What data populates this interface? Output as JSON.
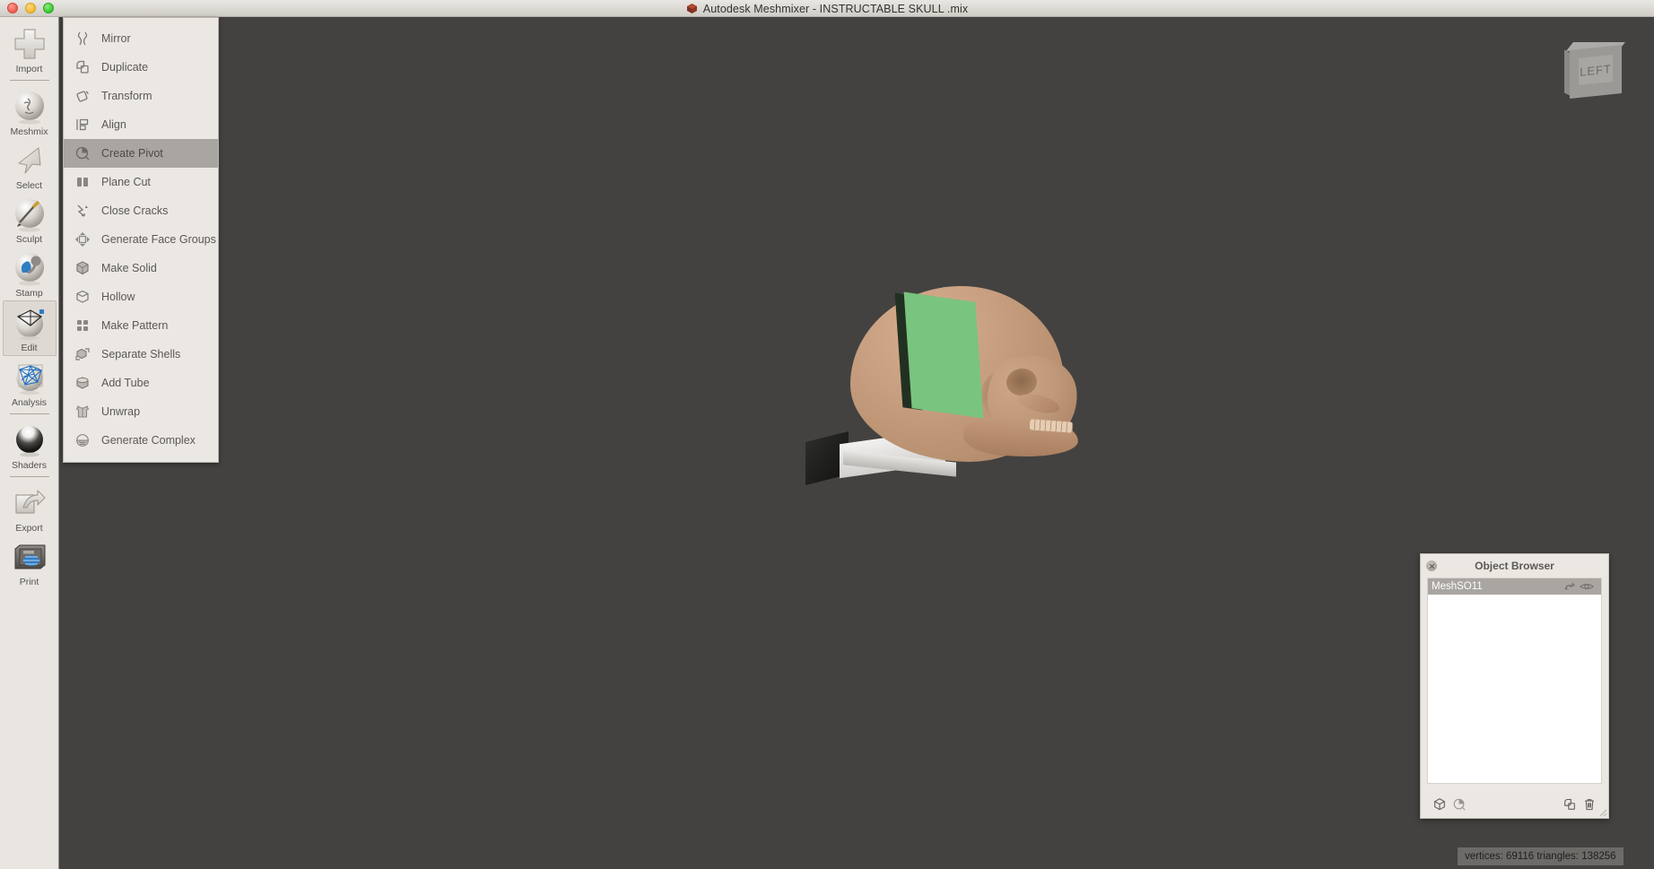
{
  "window": {
    "title": "Autodesk Meshmixer - INSTRUCTABLE SKULL .mix",
    "app_logo": "meshmixer-logo-icon",
    "traffic_lights": [
      "close-button",
      "minimize-button",
      "zoom-button"
    ]
  },
  "rail": {
    "items": [
      {
        "label": "Import",
        "icon": "plus-icon",
        "active": false,
        "separator_after": true
      },
      {
        "label": "Meshmix",
        "icon": "face-sphere-icon",
        "active": false,
        "separator_after": false
      },
      {
        "label": "Select",
        "icon": "cursor-arrow-icon",
        "active": false,
        "separator_after": false
      },
      {
        "label": "Sculpt",
        "icon": "brush-sphere-icon",
        "active": false,
        "separator_after": false
      },
      {
        "label": "Stamp",
        "icon": "stamp-sphere-icon",
        "active": false,
        "separator_after": false
      },
      {
        "label": "Edit",
        "icon": "mesh-sphere-icon",
        "active": true,
        "separator_after": false
      },
      {
        "label": "Analysis",
        "icon": "wireframe-sphere-icon",
        "active": false,
        "separator_after": true
      },
      {
        "label": "Shaders",
        "icon": "shaded-sphere-icon",
        "active": false,
        "separator_after": true
      },
      {
        "label": "Export",
        "icon": "export-arrow-icon",
        "active": false,
        "separator_after": false
      },
      {
        "label": "Print",
        "icon": "printer-icon",
        "active": false,
        "separator_after": false
      }
    ]
  },
  "edit_menu": {
    "items": [
      {
        "label": "Mirror",
        "icon": "mirror-icon",
        "selected": false
      },
      {
        "label": "Duplicate",
        "icon": "duplicate-icon",
        "selected": false
      },
      {
        "label": "Transform",
        "icon": "transform-icon",
        "selected": false
      },
      {
        "label": "Align",
        "icon": "align-icon",
        "selected": false
      },
      {
        "label": "Create Pivot",
        "icon": "pivot-icon",
        "selected": true
      },
      {
        "label": "Plane Cut",
        "icon": "plane-cut-icon",
        "selected": false
      },
      {
        "label": "Close Cracks",
        "icon": "close-cracks-icon",
        "selected": false
      },
      {
        "label": "Generate Face Groups",
        "icon": "face-groups-icon",
        "selected": false
      },
      {
        "label": "Make Solid",
        "icon": "make-solid-icon",
        "selected": false
      },
      {
        "label": "Hollow",
        "icon": "hollow-icon",
        "selected": false
      },
      {
        "label": "Make Pattern",
        "icon": "make-pattern-icon",
        "selected": false
      },
      {
        "label": "Separate Shells",
        "icon": "separate-shells-icon",
        "selected": false
      },
      {
        "label": "Add Tube",
        "icon": "add-tube-icon",
        "selected": false
      },
      {
        "label": "Unwrap",
        "icon": "unwrap-icon",
        "selected": false
      },
      {
        "label": "Generate Complex",
        "icon": "generate-complex-icon",
        "selected": false
      }
    ]
  },
  "viewport": {
    "viewcube_label": "LEFT",
    "background_color": "#434240",
    "model": {
      "name": "skull-mesh",
      "surface_color": "#c79f80",
      "pivot_plane_color": "#79c47e",
      "base_block_color": "#1a1a19",
      "base_slab_color": "#eeedea"
    }
  },
  "object_browser": {
    "title": "Object Browser",
    "close_icon": "close-icon",
    "rows": [
      {
        "name": "MeshSO11",
        "selected": true,
        "icons": [
          "magnet-icon",
          "eye-visible-icon"
        ]
      }
    ],
    "footer_icons_left": [
      "cube-icon",
      "pivot-icon"
    ],
    "footer_icons_right": [
      "duplicate-icon",
      "trash-icon"
    ],
    "resize_handle": "resize-grip-icon"
  },
  "status": {
    "text": "vertices: 69116 triangles: 138256"
  }
}
